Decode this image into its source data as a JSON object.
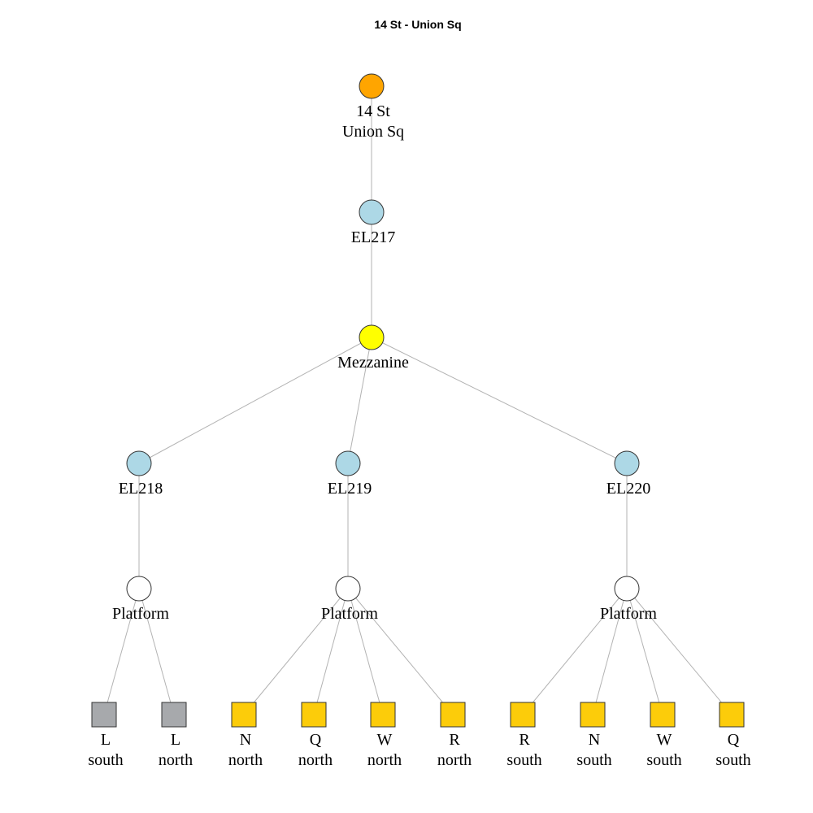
{
  "title": "14 St - Union Sq",
  "colors": {
    "station": "#FFA500",
    "elevator": "#ADD8E6",
    "mezzanine": "#FFFF00",
    "platform": "#FFFFFF",
    "line_L": "#A7A9AC",
    "line_NQRW": "#FCCC0A",
    "edge": "#B3B3B3"
  },
  "nodes": {
    "station": {
      "label": [
        "14 St",
        "Union Sq"
      ],
      "shape": "circle",
      "color": "station"
    },
    "el217": {
      "label": [
        "EL217"
      ],
      "shape": "circle",
      "color": "elevator"
    },
    "mezzanine": {
      "label": [
        "Mezzanine"
      ],
      "shape": "circle",
      "color": "mezzanine"
    },
    "el218": {
      "label": [
        "EL218"
      ],
      "shape": "circle",
      "color": "elevator"
    },
    "el219": {
      "label": [
        "EL219"
      ],
      "shape": "circle",
      "color": "elevator"
    },
    "el220": {
      "label": [
        "EL220"
      ],
      "shape": "circle",
      "color": "elevator"
    },
    "platform1": {
      "label": [
        "Platform"
      ],
      "shape": "circle",
      "color": "platform"
    },
    "platform2": {
      "label": [
        "Platform"
      ],
      "shape": "circle",
      "color": "platform"
    },
    "platform3": {
      "label": [
        "Platform"
      ],
      "shape": "circle",
      "color": "platform"
    },
    "l_south": {
      "label": [
        "L",
        "south"
      ],
      "shape": "square",
      "color": "line_L"
    },
    "l_north": {
      "label": [
        "L",
        "north"
      ],
      "shape": "square",
      "color": "line_L"
    },
    "n_north": {
      "label": [
        "N",
        "north"
      ],
      "shape": "square",
      "color": "line_NQRW"
    },
    "q_north": {
      "label": [
        "Q",
        "north"
      ],
      "shape": "square",
      "color": "line_NQRW"
    },
    "w_north": {
      "label": [
        "W",
        "north"
      ],
      "shape": "square",
      "color": "line_NQRW"
    },
    "r_north": {
      "label": [
        "R",
        "north"
      ],
      "shape": "square",
      "color": "line_NQRW"
    },
    "r_south": {
      "label": [
        "R",
        "south"
      ],
      "shape": "square",
      "color": "line_NQRW"
    },
    "n_south": {
      "label": [
        "N",
        "south"
      ],
      "shape": "square",
      "color": "line_NQRW"
    },
    "w_south": {
      "label": [
        "W",
        "south"
      ],
      "shape": "square",
      "color": "line_NQRW"
    },
    "q_south": {
      "label": [
        "Q",
        "south"
      ],
      "shape": "square",
      "color": "line_NQRW"
    }
  },
  "edges": [
    [
      "station",
      "el217"
    ],
    [
      "el217",
      "mezzanine"
    ],
    [
      "mezzanine",
      "el218"
    ],
    [
      "mezzanine",
      "el219"
    ],
    [
      "mezzanine",
      "el220"
    ],
    [
      "el218",
      "platform1"
    ],
    [
      "el219",
      "platform2"
    ],
    [
      "el220",
      "platform3"
    ],
    [
      "platform1",
      "l_south"
    ],
    [
      "platform1",
      "l_north"
    ],
    [
      "platform2",
      "n_north"
    ],
    [
      "platform2",
      "q_north"
    ],
    [
      "platform2",
      "w_north"
    ],
    [
      "platform2",
      "r_north"
    ],
    [
      "platform3",
      "r_south"
    ],
    [
      "platform3",
      "n_south"
    ],
    [
      "platform3",
      "w_south"
    ],
    [
      "platform3",
      "q_south"
    ]
  ]
}
